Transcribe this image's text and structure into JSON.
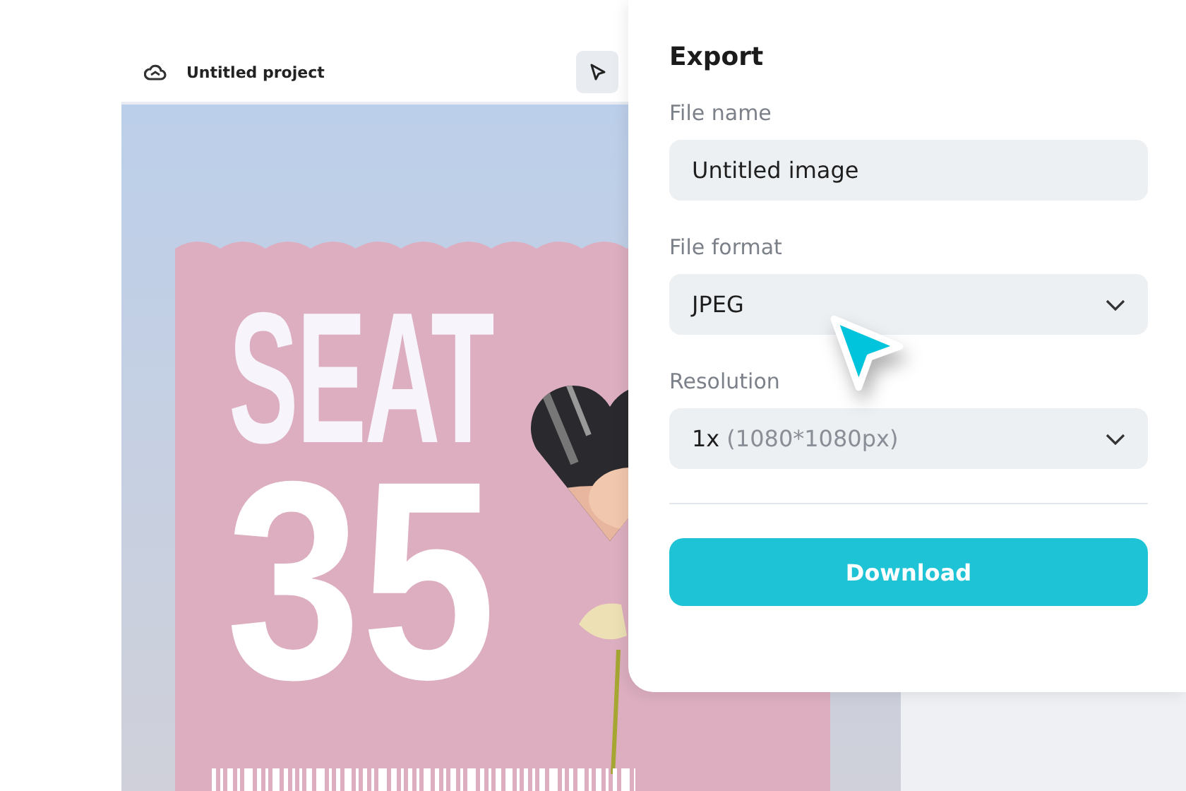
{
  "project": {
    "title": "Untitled project"
  },
  "design": {
    "headline": "SEAT",
    "number": "35"
  },
  "export": {
    "title": "Export",
    "fields": [
      {
        "kind": "text",
        "label": "File name",
        "value": "Untitled image"
      },
      {
        "kind": "select",
        "label": "File format",
        "value": "JPEG"
      },
      {
        "kind": "select",
        "label": "Resolution",
        "value": "1x",
        "detail": "(1080*1080px)"
      }
    ],
    "button": "Download"
  }
}
